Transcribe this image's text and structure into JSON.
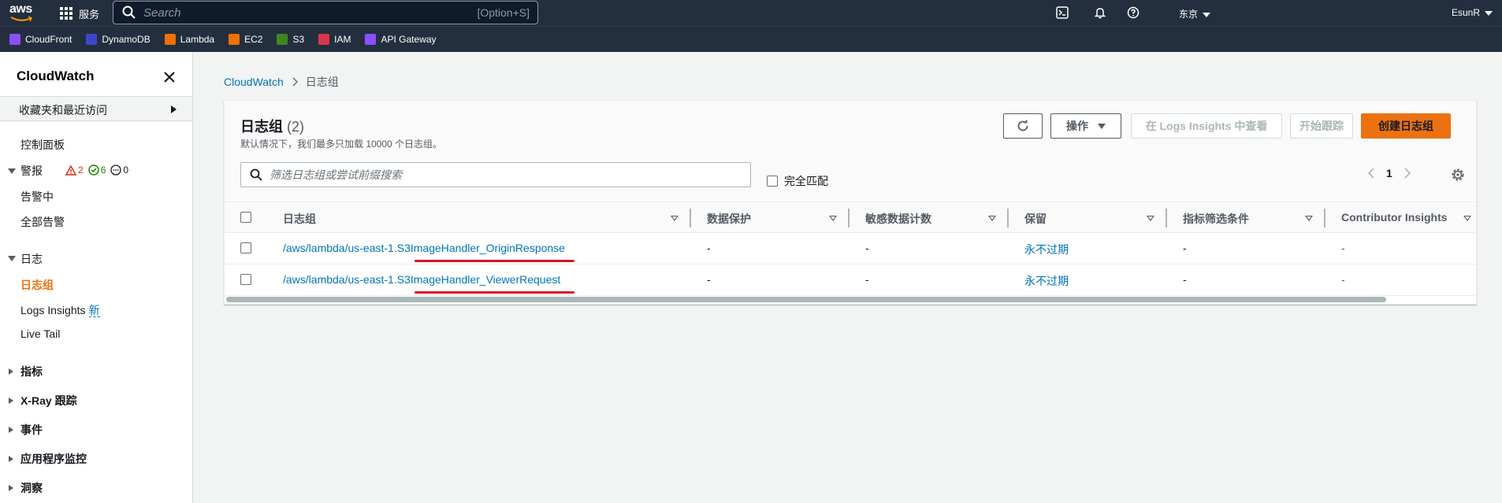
{
  "topnav": {
    "logo": "aws",
    "services_label": "服务",
    "search_placeholder": "Search",
    "search_shortcut": "[Option+S]",
    "region": "东京",
    "account": "EsunR"
  },
  "favorites": [
    {
      "label": "CloudFront",
      "color": "#8c4fff",
      "icon": "cloudfront-icon"
    },
    {
      "label": "DynamoDB",
      "color": "#3b48cc",
      "icon": "dynamodb-icon"
    },
    {
      "label": "Lambda",
      "color": "#ed7100",
      "icon": "lambda-icon"
    },
    {
      "label": "EC2",
      "color": "#ed7100",
      "icon": "ec2-icon"
    },
    {
      "label": "S3",
      "color": "#3f8624",
      "icon": "s3-icon"
    },
    {
      "label": "IAM",
      "color": "#dd344c",
      "icon": "iam-icon"
    },
    {
      "label": "API Gateway",
      "color": "#8c4fff",
      "icon": "api-gateway-icon"
    }
  ],
  "sidebar": {
    "title": "CloudWatch",
    "favorites_label": "收藏夹和最近访问",
    "dashboard": "控制面板",
    "alarms_section": "警报",
    "alarm_counts": {
      "alarm": "2",
      "ok": "6",
      "insufficient": "0"
    },
    "alarms_in_alarm": "告警中",
    "all_alarms": "全部告警",
    "logs_section": "日志",
    "log_groups": "日志组",
    "logs_insights": "Logs Insights",
    "new_tag": "新",
    "live_tail": "Live Tail",
    "metrics": "指标",
    "xray": "X-Ray 跟踪",
    "events": "事件",
    "app_monitoring": "应用程序监控",
    "insights": "洞察"
  },
  "breadcrumb": {
    "root": "CloudWatch",
    "current": "日志组"
  },
  "panel": {
    "title": "日志组",
    "count": "(2)",
    "description": "默认情况下，我们最多只加载 10000 个日志组。",
    "actions_label": "操作",
    "view_insights": "在 Logs Insights 中查看",
    "start_tail": "开始跟踪",
    "create": "创建日志组",
    "filter_placeholder": "筛选日志组或尝试前缀搜索",
    "exact_match": "完全匹配",
    "page": "1"
  },
  "table": {
    "columns": [
      "日志组",
      "数据保护",
      "敏感数据计数",
      "保留",
      "指标筛选条件",
      "Contributor Insights"
    ],
    "rows": [
      {
        "name": "/aws/lambda/us-east-1.S3ImageHandler_OriginResponse",
        "protection": "-",
        "sensitive": "-",
        "retention": "永不过期",
        "filters": "-",
        "contributor": "-"
      },
      {
        "name": "/aws/lambda/us-east-1.S3ImageHandler_ViewerRequest",
        "protection": "-",
        "sensitive": "-",
        "retention": "永不过期",
        "filters": "-",
        "contributor": "-"
      }
    ]
  },
  "colors": {
    "nav_bg": "#232f3e",
    "accent": "#ec7211",
    "link": "#0073bb",
    "annotation": "#e0102a"
  }
}
